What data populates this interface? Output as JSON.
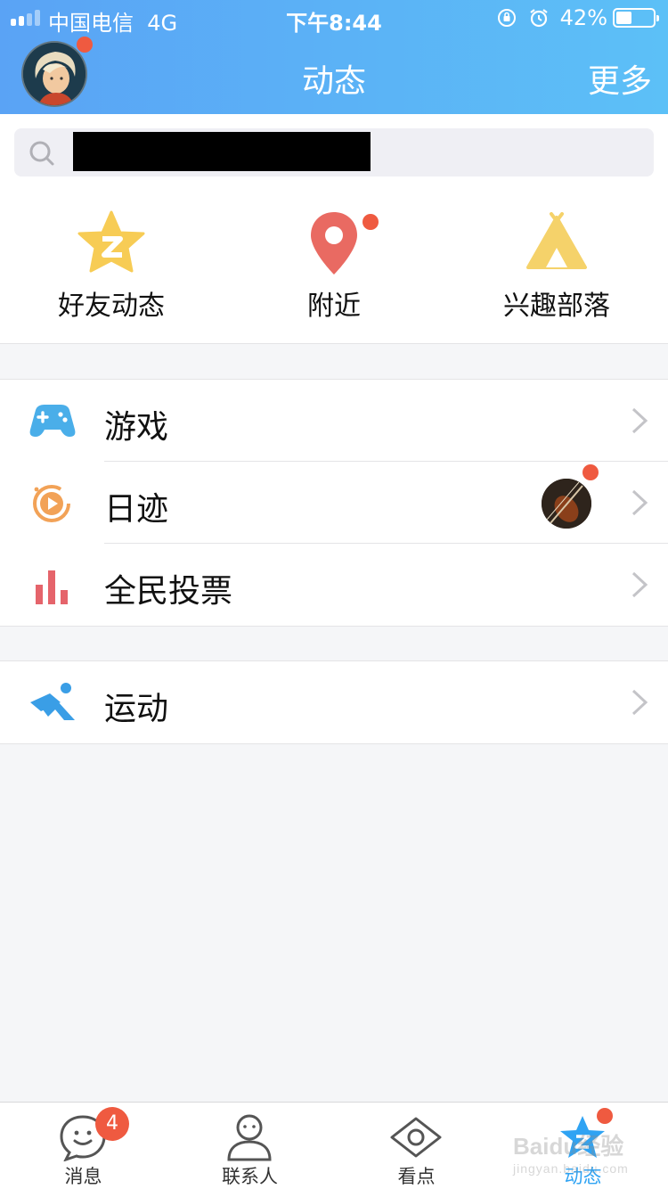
{
  "status_bar": {
    "carrier": "中国电信",
    "network": "4G",
    "time": "下午8:44",
    "battery_text": "42%",
    "battery_level": 0.42
  },
  "header": {
    "title": "动态",
    "more_label": "更多",
    "avatar_icon": "user-avatar-icon",
    "avatar_has_dot": true
  },
  "search": {
    "value": "",
    "icon": "search-icon"
  },
  "quick_entries": [
    {
      "label": "好友动态",
      "icon": "qzone-star-icon",
      "color": "#f7cc55",
      "has_dot": false
    },
    {
      "label": "附近",
      "icon": "location-pin-icon",
      "color": "#e96a62",
      "has_dot": true
    },
    {
      "label": "兴趣部落",
      "icon": "tent-icon",
      "color": "#f5d26a",
      "has_dot": false
    }
  ],
  "groups": [
    {
      "rows": [
        {
          "label": "游戏",
          "icon": "gamepad-icon",
          "color": "#4aaee9"
        },
        {
          "label": "日迹",
          "icon": "play-circle-icon",
          "color": "#f2a257",
          "has_thumb": true,
          "thumb_has_dot": true
        },
        {
          "label": "全民投票",
          "icon": "bar-chart-icon",
          "color": "#e5646b"
        }
      ]
    },
    {
      "rows": [
        {
          "label": "运动",
          "icon": "running-icon",
          "color": "#3a9ee6"
        }
      ]
    }
  ],
  "tabbar": {
    "tabs": [
      {
        "label": "消息",
        "icon": "message-smile-icon",
        "badge": "4",
        "active": false
      },
      {
        "label": "联系人",
        "icon": "contact-person-icon",
        "active": false
      },
      {
        "label": "看点",
        "icon": "eye-icon",
        "active": false
      },
      {
        "label": "动态",
        "icon": "star-dynamic-icon",
        "active": true,
        "has_dot": true
      }
    ]
  },
  "watermark": {
    "text": "Baidu经验",
    "subtext": "jingyan.baidu.com"
  },
  "colors": {
    "header_start": "#5aa3f5",
    "header_end": "#5cc0f7",
    "badge": "#ef5a40",
    "active_tab": "#2fa3f3",
    "background": "#f5f6f8"
  }
}
